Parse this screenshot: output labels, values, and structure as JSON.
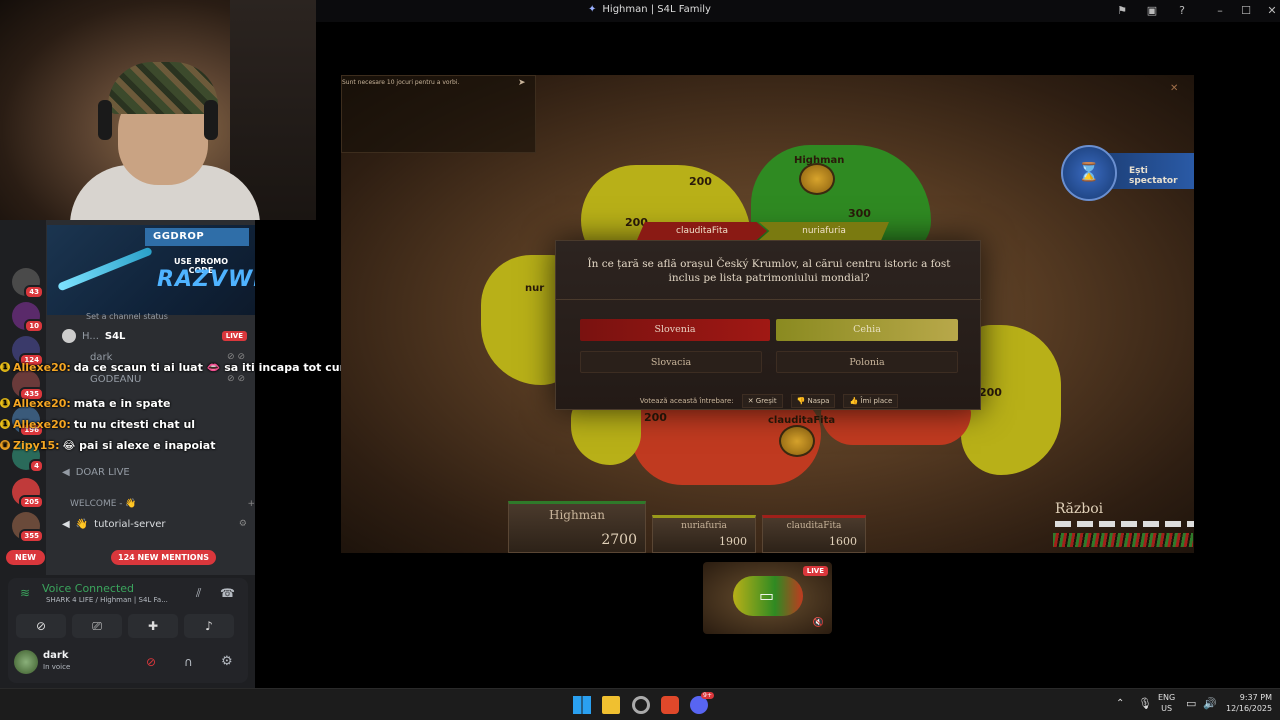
{
  "window": {
    "title": "Highman | S4L Family"
  },
  "promo": {
    "brand": "GGDROP",
    "line1": "USE PROMO CODE",
    "code": "RAZVWI"
  },
  "channel": {
    "status_placeholder": "Set a channel status",
    "live_user": "H...",
    "live_tag": "S4L",
    "live_badge": "LIVE",
    "members": [
      "dark",
      "GODEANU"
    ],
    "doar_live": "DOAR LIVE",
    "welcome_header": "WELCOME - 👋",
    "tutorial": "tutorial-server",
    "new_label": "NEW",
    "mentions": "124 NEW MENTIONS"
  },
  "servers": [
    {
      "badge": "43",
      "color": "#4a4a4a"
    },
    {
      "badge": "10",
      "color": "#5a2a6a"
    },
    {
      "badge": "124",
      "color": "#3a3a6a"
    },
    {
      "badge": "435",
      "color": "#6a3a3a"
    },
    {
      "badge": "196",
      "color": "#3a5a7a"
    },
    {
      "badge": "4",
      "color": "#2a6a5a"
    },
    {
      "badge": "205",
      "color": "#c03a3a"
    },
    {
      "badge": "355",
      "color": "#6a4a3a"
    }
  ],
  "chat_overlay": [
    {
      "user": "Allexe20:",
      "msg": "da ce scaun ti ai luat 👄 sa iti incapa tot curul?"
    },
    {
      "user": "Allexe20:",
      "msg": "mata e in spate"
    },
    {
      "user": "Allexe20:",
      "msg": "tu nu citesti chat ul"
    },
    {
      "user": "Zipy15:",
      "msg": "😂 pai si alexe e inapoiat"
    }
  ],
  "voice": {
    "title": "Voice Connected",
    "subtitle": "SHARK 4 LIFE / Highman | S4L Fa..."
  },
  "user": {
    "name": "dark",
    "status": "In voice"
  },
  "game": {
    "chat_notice": "Sunt necesare 10 jocuri pentru a vorbi.",
    "spectator": "Ești spectator",
    "map_values": [
      "200",
      "200",
      "300",
      "200",
      "200"
    ],
    "map_player_labels": [
      "Highman",
      "clauditaFita",
      "nur"
    ],
    "versus": {
      "left": "clauditaFita",
      "right": "nuriafuria"
    },
    "question": "În ce țară se află orașul Český Krumlov, al cărui centru istoric a fost inclus pe lista patrimoniului mondial?",
    "answers": [
      "Slovenia",
      "Cehia",
      "Slovacia",
      "Polonia"
    ],
    "vote_label": "Votează această întrebare:",
    "vote_wrong": "Greșit",
    "vote_bad": "Naspa",
    "vote_like": "Îmi place",
    "players": [
      {
        "name": "Highman",
        "score": "2700",
        "color": "#2f7a2a"
      },
      {
        "name": "nuriafuria",
        "score": "1900",
        "color": "#9a9a1a"
      },
      {
        "name": "clauditaFita",
        "score": "1600",
        "color": "#a0201a"
      }
    ],
    "war_label": "Război"
  },
  "stream_preview": {
    "live": "LIVE"
  },
  "taskbar": {
    "lang": "ENG",
    "region": "US",
    "time": "9:37 PM",
    "date": "12/16/2025",
    "discord_badge": "9+"
  }
}
